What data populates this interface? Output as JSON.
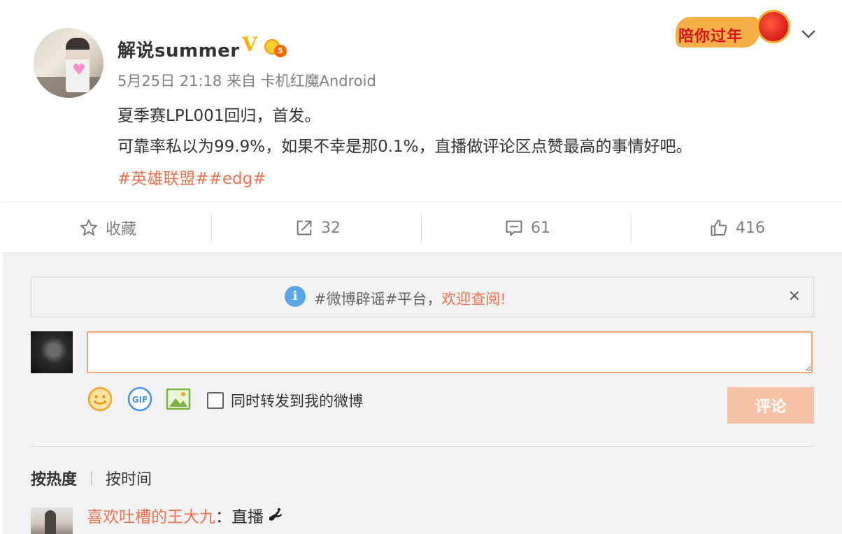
{
  "post": {
    "username": "解说summer",
    "verified_mark": "V",
    "level_badge": "5",
    "meta": "5月25日 21:18 来自 卡机红魔Android",
    "line1": "夏季赛LPL001回归，首发。",
    "line2": "可靠率私以为99.9%，如果不幸是那0.1%，直播做评论区点赞最高的事情好吧。",
    "tags": "#英雄联盟##edg#",
    "festival_label": "陪你过年"
  },
  "actions": {
    "favorite_label": "收藏",
    "repost_count": "32",
    "comment_count": "61",
    "like_count": "416"
  },
  "notice": {
    "text": "#微博辟谣#平台，",
    "highlight": "欢迎查阅!",
    "close": "×"
  },
  "composer": {
    "placeholder": "",
    "repost_label": "同时转发到我的微博",
    "submit_label": "评论"
  },
  "sort": {
    "hot": "按热度",
    "time": "按时间"
  },
  "comments": [
    {
      "name": "喜欢吐槽的王大九",
      "separator": "：",
      "text": "直播"
    }
  ],
  "colors": {
    "accent": "#eb7350",
    "submit_disabled": "#f7c3a6",
    "verified": "#f7b500",
    "panel_bg": "#f2f2f5"
  },
  "icons": {
    "more": "chevron-down-icon",
    "favorite": "star-icon",
    "repost": "share-arrow-icon",
    "comment": "comment-bubble-icon",
    "like": "thumbs-up-icon",
    "info": "info-icon",
    "emoji": "smiley-icon",
    "gif": "gif-icon",
    "picture": "image-icon",
    "comment_emoji": "sticker-icon"
  }
}
